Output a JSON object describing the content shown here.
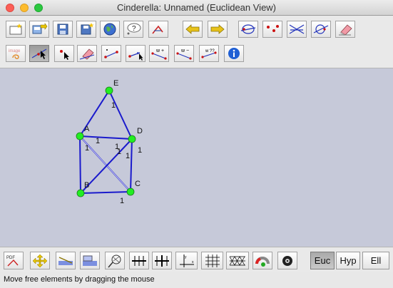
{
  "window": {
    "title": "Cinderella: Unnamed (Euclidean View)"
  },
  "toolbar_row1": [
    {
      "id": "new",
      "icon": "new-document-icon"
    },
    {
      "id": "load",
      "icon": "open-file-icon"
    },
    {
      "id": "save",
      "icon": "save-icon"
    },
    {
      "id": "save-as",
      "icon": "save-as-icon"
    },
    {
      "id": "export-web",
      "icon": "globe-icon"
    },
    {
      "id": "help",
      "icon": "help-balloon-icon"
    },
    {
      "id": "pdf",
      "icon": "print-icon"
    },
    {
      "id": "undo",
      "icon": "arrow-left-icon"
    },
    {
      "id": "redo",
      "icon": "arrow-right-icon"
    },
    {
      "id": "select-lines",
      "icon": "select-lines-icon"
    },
    {
      "id": "select-points",
      "icon": "select-points-icon"
    },
    {
      "id": "select-all-lines",
      "icon": "select-all-icon"
    },
    {
      "id": "select-conics",
      "icon": "select-conics-icon"
    },
    {
      "id": "erase",
      "icon": "eraser-icon"
    }
  ],
  "toolbar_row2": [
    {
      "id": "image-mode",
      "icon": "image-icon"
    },
    {
      "id": "move",
      "icon": "move-icon",
      "pressed": true
    },
    {
      "id": "add-point",
      "icon": "add-point-icon"
    },
    {
      "id": "delete-mode",
      "icon": "delete-icon"
    },
    {
      "id": "add-segment",
      "icon": "add-segment-icon"
    },
    {
      "id": "add-arrow",
      "icon": "add-arrow-icon"
    },
    {
      "id": "add-weight",
      "label": "w +",
      "icon": "add-weight-icon"
    },
    {
      "id": "remove-weight",
      "label": "w −",
      "icon": "remove-weight-icon"
    },
    {
      "id": "query-weight",
      "label": "w ??",
      "icon": "query-weight-icon"
    },
    {
      "id": "info",
      "icon": "info-icon"
    }
  ],
  "graph": {
    "vertices": [
      {
        "name": "E"
      },
      {
        "name": "A"
      },
      {
        "name": "D"
      },
      {
        "name": "B"
      },
      {
        "name": "C"
      }
    ],
    "edges": [
      {
        "from": "E",
        "to": "A",
        "weight": "1"
      },
      {
        "from": "E",
        "to": "D",
        "weight": "1"
      },
      {
        "from": "A",
        "to": "D",
        "weight": "1"
      },
      {
        "from": "A",
        "to": "B",
        "weight": "1"
      },
      {
        "from": "A",
        "to": "C",
        "weight": "1"
      },
      {
        "from": "B",
        "to": "D",
        "weight": "1"
      },
      {
        "from": "D",
        "to": "C",
        "weight": "1"
      },
      {
        "from": "B",
        "to": "C",
        "weight": "1"
      }
    ],
    "edge_color": "#1a1acc",
    "point_color": "#22ee22"
  },
  "bottom_tools": [
    {
      "id": "pdf-export",
      "icon": "pdf-icon"
    },
    {
      "id": "fit-view",
      "icon": "fit-view-icon"
    },
    {
      "id": "translate",
      "icon": "translate-icon"
    },
    {
      "id": "layer",
      "icon": "layer-icon"
    },
    {
      "id": "net",
      "icon": "net-icon"
    },
    {
      "id": "zoom-grid",
      "icon": "zoom-grid-icon"
    },
    {
      "id": "axes",
      "icon": "axes-icon"
    },
    {
      "id": "grid",
      "icon": "grid-icon"
    },
    {
      "id": "tri-grid",
      "icon": "triangle-grid-icon"
    },
    {
      "id": "snap",
      "icon": "snap-icon"
    },
    {
      "id": "animation",
      "icon": "camera-icon"
    }
  ],
  "geometry_buttons": [
    {
      "id": "euc",
      "label": "Euc",
      "active": true
    },
    {
      "id": "hyp",
      "label": "Hyp",
      "active": false
    },
    {
      "id": "ell",
      "label": "Ell",
      "active": false
    }
  ],
  "status": {
    "text": "Move free elements by dragging the mouse"
  }
}
